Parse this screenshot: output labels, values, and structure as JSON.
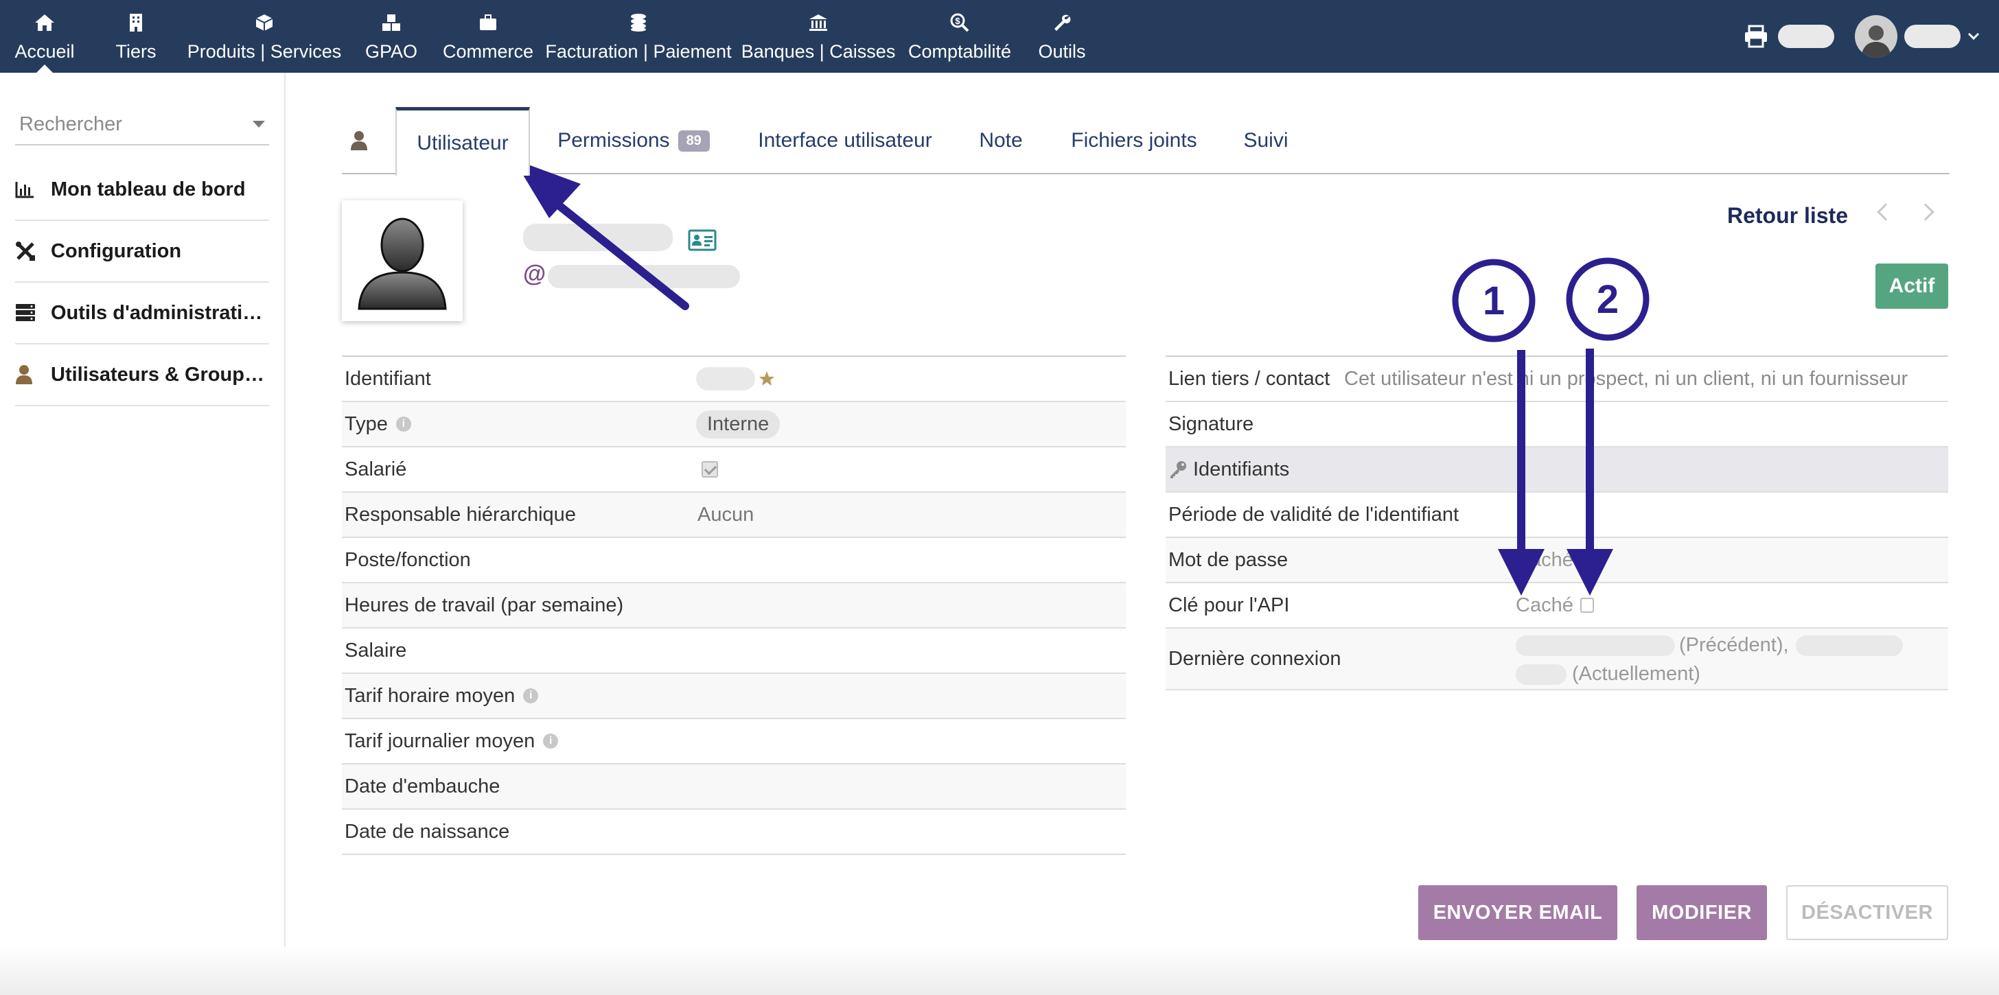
{
  "nav": {
    "items": [
      {
        "label": "Accueil",
        "icon": "home-icon"
      },
      {
        "label": "Tiers",
        "icon": "building-icon"
      },
      {
        "label": "Produits | Services",
        "icon": "cube-icon"
      },
      {
        "label": "GPAO",
        "icon": "cubes-icon"
      },
      {
        "label": "Commerce",
        "icon": "briefcase-icon"
      },
      {
        "label": "Facturation | Paiement",
        "icon": "coins-icon"
      },
      {
        "label": "Banques | Caisses",
        "icon": "bank-icon"
      },
      {
        "label": "Comptabilité",
        "icon": "search-dollar-icon"
      },
      {
        "label": "Outils",
        "icon": "wrench-icon"
      }
    ]
  },
  "sidebar": {
    "search_placeholder": "Rechercher",
    "items": [
      {
        "label": "Mon tableau de bord",
        "icon": "chart-icon"
      },
      {
        "label": "Configuration",
        "icon": "tools-icon"
      },
      {
        "label": "Outils d'administrati…",
        "icon": "server-icon"
      },
      {
        "label": "Utilisateurs & Group…",
        "icon": "user-icon"
      }
    ]
  },
  "tabs": {
    "user_tab": "Utilisateur",
    "permissions": "Permissions",
    "permissions_count": "89",
    "interface": "Interface utilisateur",
    "note": "Note",
    "files": "Fichiers joints",
    "follow": "Suivi"
  },
  "header": {
    "retour": "Retour liste",
    "status": "Actif"
  },
  "left_fields": [
    {
      "label": "Identifiant",
      "value": ""
    },
    {
      "label": "Type",
      "value": "Interne"
    },
    {
      "label": "Salarié",
      "value": ""
    },
    {
      "label": "Responsable hiérarchique",
      "value": "Aucun"
    },
    {
      "label": "Poste/fonction",
      "value": ""
    },
    {
      "label": "Heures de travail (par semaine)",
      "value": ""
    },
    {
      "label": "Salaire",
      "value": ""
    },
    {
      "label": "Tarif horaire moyen",
      "value": ""
    },
    {
      "label": "Tarif journalier moyen",
      "value": ""
    },
    {
      "label": "Date d'embauche",
      "value": ""
    },
    {
      "label": "Date de naissance",
      "value": ""
    }
  ],
  "right_fields": {
    "link_label": "Lien tiers / contact",
    "link_value": "Cet utilisateur n'est ni un prospect, ni un client, ni un fournisseur",
    "signature": "Signature",
    "section": "Identifiants",
    "validity": "Période de validité de l'identifiant",
    "password": "Mot de passe",
    "password_value": "Caché",
    "api_key": "Clé pour l'API",
    "api_value": "Caché",
    "last_login": "Dernière connexion",
    "previous": "(Précédent),",
    "current": "(Actuellement)"
  },
  "buttons": {
    "send_email": "ENVOYER EMAIL",
    "modify": "MODIFIER",
    "disable": "DÉSACTIVER"
  },
  "annotations": {
    "marker_1": "1",
    "marker_2": "2",
    "color": "#2c1f8f"
  }
}
